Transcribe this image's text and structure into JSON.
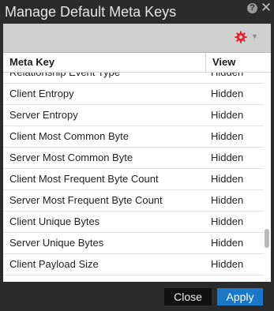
{
  "dialog": {
    "title": "Manage Default Meta Keys",
    "icons": {
      "help": "help-icon",
      "close": "close-icon",
      "settings": "gear-icon",
      "dropdown": "caret-down-icon"
    },
    "accent_color": "#e8202a"
  },
  "table": {
    "columns": [
      "Meta Key",
      "View"
    ],
    "rows": [
      {
        "key": "Relationship Event Type",
        "view": "Hidden"
      },
      {
        "key": "Client Entropy",
        "view": "Hidden"
      },
      {
        "key": "Server Entropy",
        "view": "Hidden"
      },
      {
        "key": "Client Most Common Byte",
        "view": "Hidden"
      },
      {
        "key": "Server Most Common Byte",
        "view": "Hidden"
      },
      {
        "key": "Client Most Frequent Byte Count",
        "view": "Hidden"
      },
      {
        "key": "Server Most Frequent Byte Count",
        "view": "Hidden"
      },
      {
        "key": "Client Unique Bytes",
        "view": "Hidden"
      },
      {
        "key": "Server Unique Bytes",
        "view": "Hidden"
      },
      {
        "key": "Client Payload Size",
        "view": "Hidden"
      }
    ]
  },
  "footer": {
    "close_label": "Close",
    "apply_label": "Apply"
  }
}
